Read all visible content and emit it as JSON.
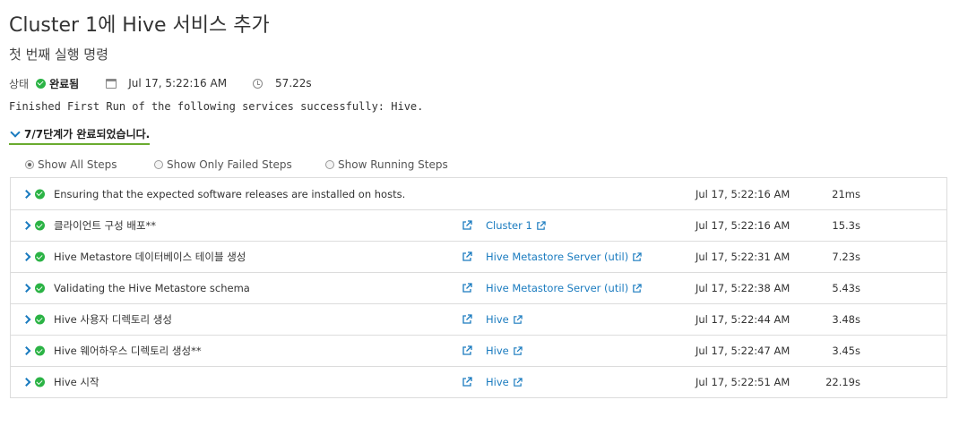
{
  "page": {
    "title": "Cluster 1에 Hive 서비스 추가",
    "subtitle": "첫 번째 실행 명령"
  },
  "status": {
    "label": "상태",
    "value": "완료됨",
    "date": "Jul 17, 5:22:16 AM",
    "duration": "57.22s",
    "color": "#2bb345"
  },
  "message": "Finished First Run of the following services successfully: Hive.",
  "steps_summary": "7/7단계가 완료되었습니다.",
  "filters": [
    {
      "label": "Show All Steps",
      "selected": true
    },
    {
      "label": "Show Only Failed Steps",
      "selected": false
    },
    {
      "label": "Show Running Steps",
      "selected": false
    }
  ],
  "steps": [
    {
      "description": "Ensuring that the expected software releases are installed on hosts.",
      "link": "",
      "time": "Jul 17, 5:22:16 AM",
      "duration": "21ms"
    },
    {
      "description": "클라이언트 구성 배포**",
      "link": "Cluster 1",
      "time": "Jul 17, 5:22:16 AM",
      "duration": "15.3s"
    },
    {
      "description": "Hive Metastore 데이터베이스 테이블 생성",
      "link": "Hive Metastore Server (util)",
      "time": "Jul 17, 5:22:31 AM",
      "duration": "7.23s"
    },
    {
      "description": "Validating the Hive Metastore schema",
      "link": "Hive Metastore Server (util)",
      "time": "Jul 17, 5:22:38 AM",
      "duration": "5.43s"
    },
    {
      "description": "Hive 사용자 디렉토리 생성",
      "link": "Hive",
      "time": "Jul 17, 5:22:44 AM",
      "duration": "3.48s"
    },
    {
      "description": "Hive 웨어하우스 디렉토리 생성**",
      "link": "Hive",
      "time": "Jul 17, 5:22:47 AM",
      "duration": "3.45s"
    },
    {
      "description": "Hive 시작",
      "link": "Hive",
      "time": "Jul 17, 5:22:51 AM",
      "duration": "22.19s"
    }
  ],
  "colors": {
    "accent": "#1a7bbf",
    "success": "#2bb345",
    "underline": "#6aab2f",
    "border": "#dcdcdc"
  }
}
